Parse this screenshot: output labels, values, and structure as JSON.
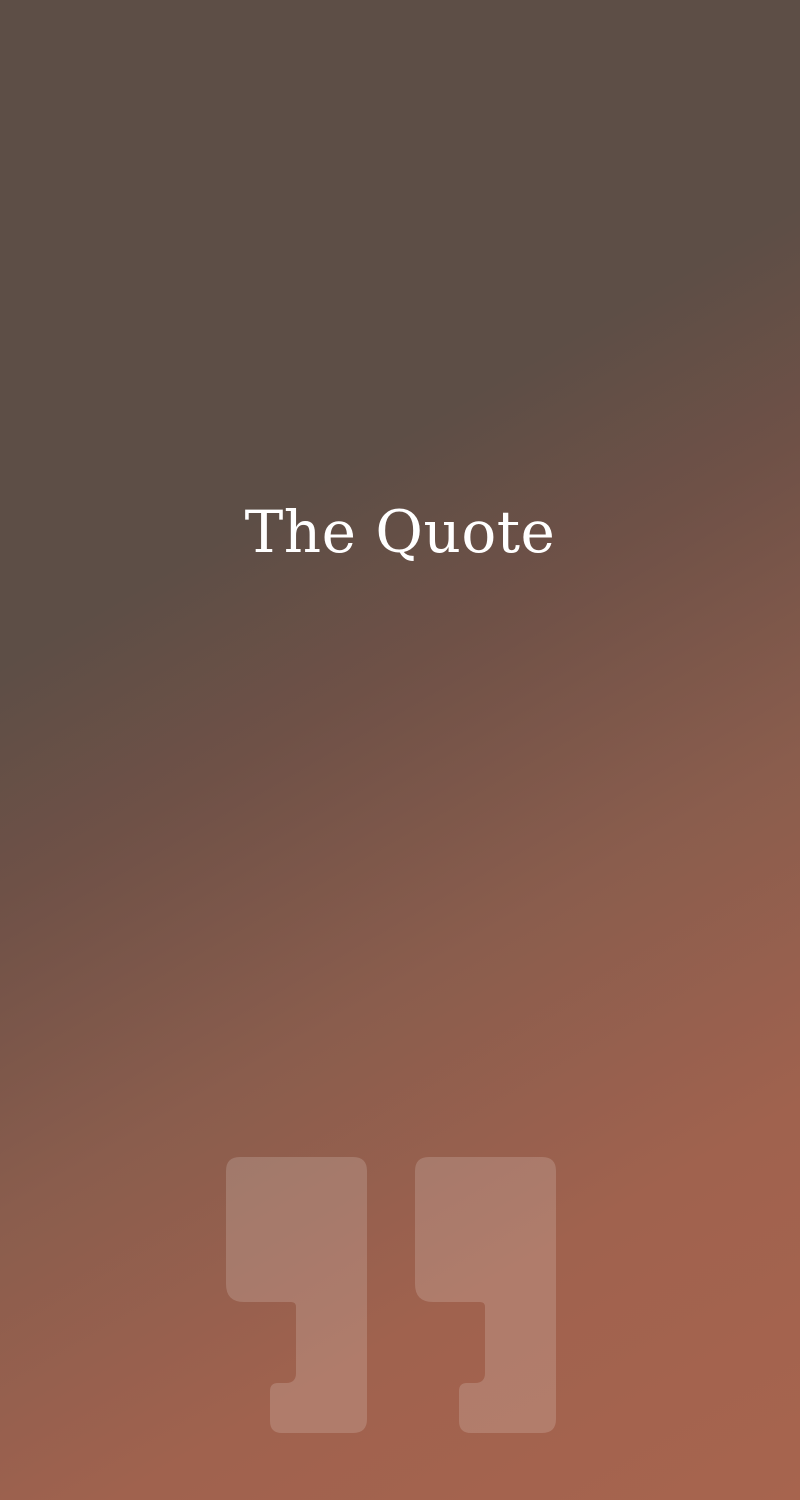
{
  "screen": {
    "title": "The Quote"
  },
  "icons": {
    "quote_mark": "closing-quote-icon"
  },
  "colors": {
    "background_top": "#5d4e46",
    "background_bottom": "#a7644e",
    "title_text": "#ffffff",
    "quote_mark_fill": "rgba(255,255,255,0.17)"
  }
}
